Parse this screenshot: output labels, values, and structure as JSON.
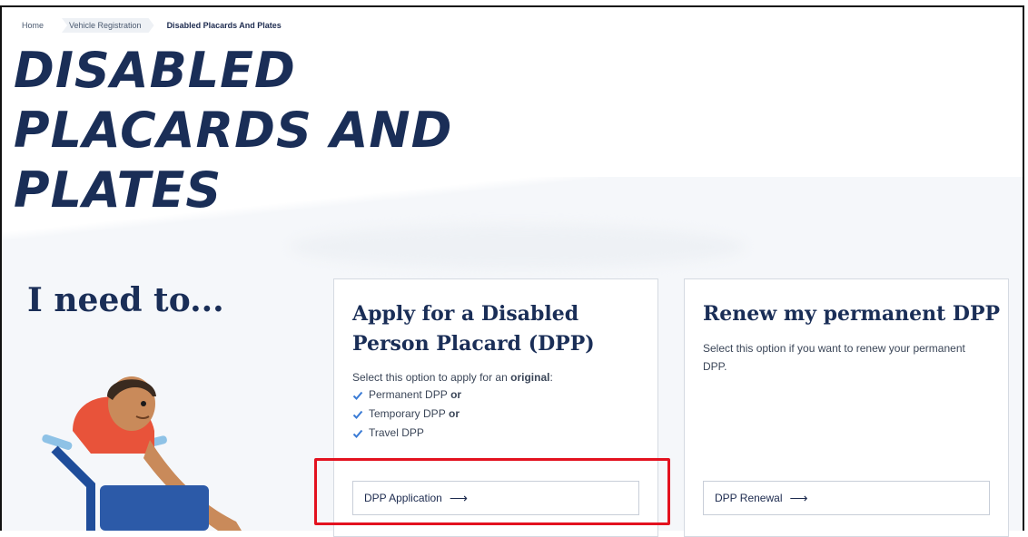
{
  "breadcrumb": {
    "items": [
      "Home",
      "Vehicle Registration",
      "Disabled Placards And Plates"
    ]
  },
  "page": {
    "title_lines": [
      "DISABLED",
      "PLACARDS AND",
      "PLATES"
    ],
    "need_to": "I need to..."
  },
  "cards": [
    {
      "title": "Apply for a Disabled Person Placard (DPP)",
      "desc_prefix": "Select this option to apply for an ",
      "desc_strong": "original",
      "desc_suffix": ":",
      "checklist": [
        {
          "text": "Permanent DPP",
          "suffix": "or"
        },
        {
          "text": "Temporary DPP",
          "suffix": "or"
        },
        {
          "text": "Travel DPP",
          "suffix": ""
        }
      ],
      "button": "DPP Application"
    },
    {
      "title": "Renew my permanent DPP",
      "desc": "Select this option if you want to renew your permanent DPP.",
      "button": "DPP Renewal"
    }
  ],
  "icons": {
    "arrow": "arrow-right-icon",
    "check": "check-icon"
  },
  "colors": {
    "title": "#1a2e57",
    "check": "#3a7bd5",
    "highlight": "#e3121f"
  }
}
